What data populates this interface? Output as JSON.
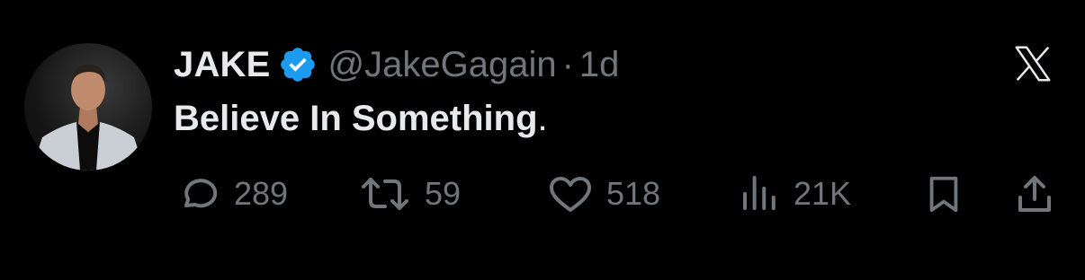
{
  "author": {
    "name": "JAKE",
    "handle": "@JakeGagain",
    "separator": "·",
    "time": "1d",
    "verified_color": "#1d9bf0"
  },
  "tweet": {
    "text": "Believe In Something",
    "trailing": "."
  },
  "actions": {
    "replies": "289",
    "reposts": "59",
    "likes": "518",
    "views": "21K"
  },
  "icons": {
    "reply": "reply-icon",
    "repost": "repost-icon",
    "like": "heart-icon",
    "views": "views-icon",
    "bookmark": "bookmark-icon",
    "share": "share-icon",
    "brand": "x-logo-icon"
  },
  "colors": {
    "background": "#000000",
    "primary_text": "#e7e9ea",
    "secondary_text": "#71767b"
  }
}
